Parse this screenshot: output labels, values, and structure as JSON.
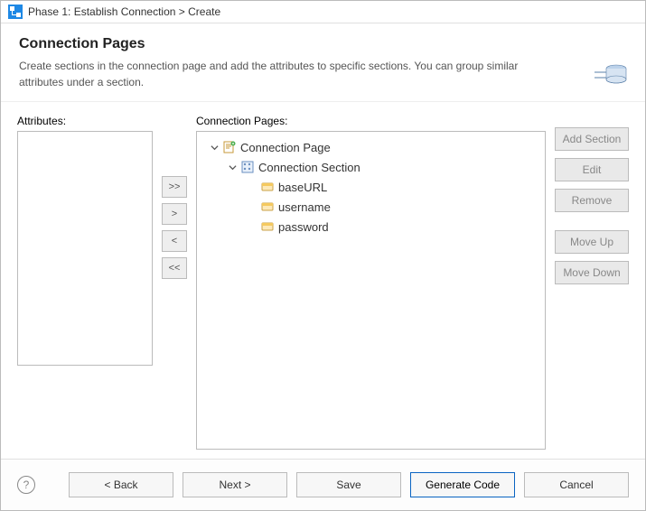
{
  "titlebar": {
    "text": "Phase 1: Establish Connection > Create"
  },
  "header": {
    "title": "Connection Pages",
    "description": "Create sections in the connection page and add the attributes to specific sections. You can group similar attributes under a section."
  },
  "panels": {
    "attributes_label": "Attributes:",
    "pages_label": "Connection Pages:"
  },
  "tree": {
    "root": {
      "label": "Connection Page"
    },
    "section": {
      "label": "Connection Section"
    },
    "attrs": [
      {
        "label": "baseURL"
      },
      {
        "label": "username"
      },
      {
        "label": "password"
      }
    ]
  },
  "arrow_buttons": {
    "move_all_right": ">>",
    "move_right": ">",
    "move_left": "<",
    "move_all_left": "<<"
  },
  "side_buttons": {
    "add_section": "Add Section",
    "edit": "Edit",
    "remove": "Remove",
    "move_up": "Move Up",
    "move_down": "Move Down"
  },
  "footer": {
    "back": "< Back",
    "next": "Next >",
    "save": "Save",
    "generate": "Generate Code",
    "cancel": "Cancel"
  }
}
